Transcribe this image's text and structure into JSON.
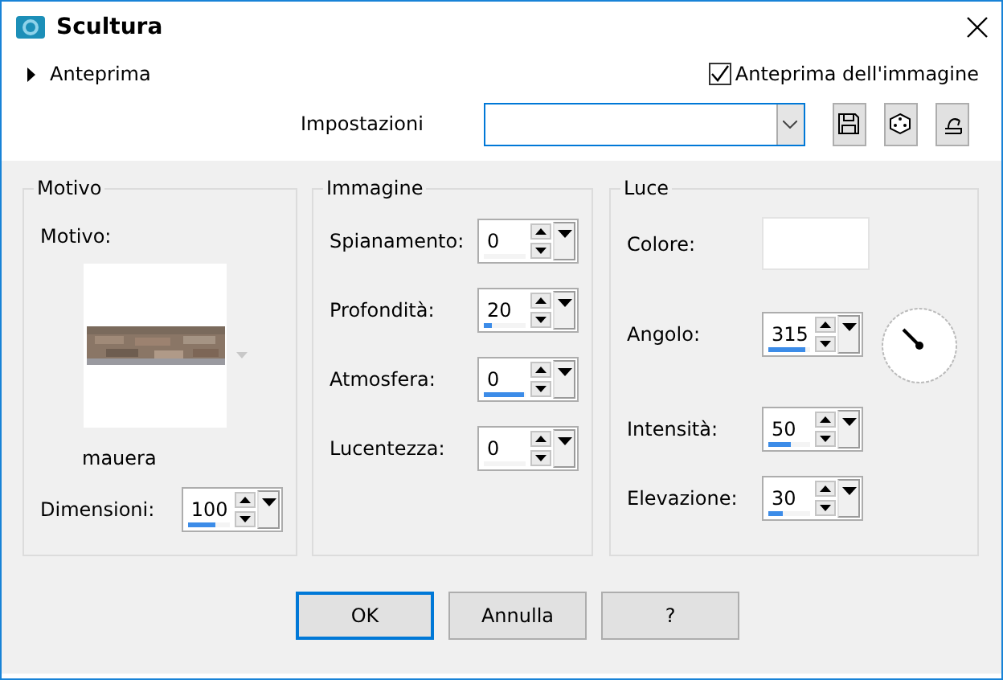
{
  "window": {
    "title": "Scultura"
  },
  "preview_toggle": {
    "label": "Anteprima",
    "expanded": false
  },
  "image_preview": {
    "label": "Anteprima dell'immagine",
    "checked": true
  },
  "presets": {
    "label": "Impostazioni"
  },
  "motivo": {
    "title": "Motivo",
    "pattern_label": "Motivo:",
    "pattern_name": "mauera",
    "size": {
      "label": "Dimensioni:",
      "value": "100",
      "level": 0.65
    }
  },
  "immagine": {
    "title": "Immagine",
    "fields": [
      {
        "label": "Spianamento:",
        "value": "0",
        "level": 0
      },
      {
        "label": "Profondità:",
        "value": "20",
        "level": 0.2
      },
      {
        "label": "Atmosfera:",
        "value": "0",
        "level": 0.95
      },
      {
        "label": "Lucentezza:",
        "value": "0",
        "level": 0
      }
    ]
  },
  "luce": {
    "title": "Luce",
    "color_label": "Colore:",
    "color": "#ffffff",
    "fields": [
      {
        "label": "Angolo:",
        "value": "315",
        "level": 0.9
      },
      {
        "label": "Intensità:",
        "value": "50",
        "level": 0.55
      },
      {
        "label": "Elevazione:",
        "value": "30",
        "level": 0.35
      }
    ]
  },
  "buttons": [
    {
      "label": "OK",
      "default": true
    },
    {
      "label": "Annulla",
      "default": false
    },
    {
      "label": "?",
      "default": false
    }
  ]
}
